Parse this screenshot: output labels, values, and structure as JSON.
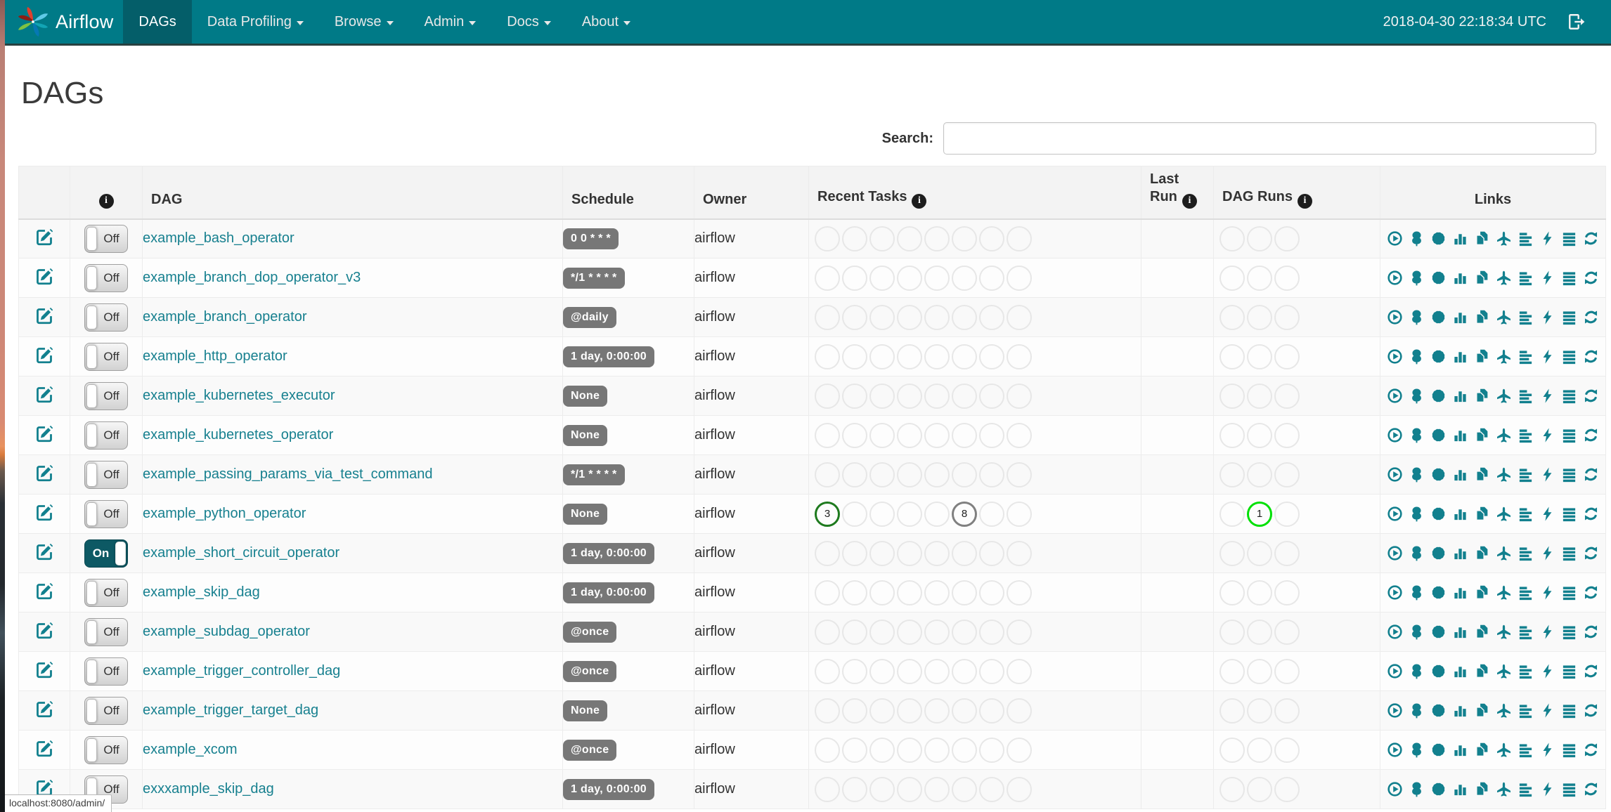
{
  "navbar": {
    "brand": "Airflow",
    "items": [
      {
        "label": "DAGs",
        "active": true,
        "caret": false
      },
      {
        "label": "Data Profiling",
        "active": false,
        "caret": true
      },
      {
        "label": "Browse",
        "active": false,
        "caret": true
      },
      {
        "label": "Admin",
        "active": false,
        "caret": true
      },
      {
        "label": "Docs",
        "active": false,
        "caret": true
      },
      {
        "label": "About",
        "active": false,
        "caret": true
      }
    ],
    "clock": "2018-04-30 22:18:34 UTC"
  },
  "page": {
    "title": "DAGs",
    "search_label": "Search:",
    "search_value": "",
    "status_bar": "localhost:8080/admin/"
  },
  "icons": {
    "info_glyph": "i"
  },
  "table": {
    "headers": {
      "dag": "DAG",
      "schedule": "Schedule",
      "owner": "Owner",
      "recent_tasks": "Recent Tasks",
      "last_run_line1": "Last",
      "last_run_line2": "Run",
      "dag_runs": "DAG Runs",
      "links": "Links"
    },
    "toggle": {
      "on_label": "On",
      "off_label": "Off"
    },
    "recent_task_slots": 8,
    "dag_run_slots": 3,
    "link_icons": [
      "play-circle",
      "tree",
      "starburst",
      "bar-chart",
      "duplicate",
      "plane",
      "align-left",
      "flash",
      "align-justify",
      "refresh"
    ],
    "rows": [
      {
        "name": "example_bash_operator",
        "schedule": "0 0 * * *",
        "owner": "airflow",
        "enabled": false,
        "last_run": "",
        "recent_tasks": {},
        "dag_runs": {}
      },
      {
        "name": "example_branch_dop_operator_v3",
        "schedule": "*/1 * * * *",
        "owner": "airflow",
        "enabled": false,
        "last_run": "",
        "recent_tasks": {},
        "dag_runs": {}
      },
      {
        "name": "example_branch_operator",
        "schedule": "@daily",
        "owner": "airflow",
        "enabled": false,
        "last_run": "",
        "recent_tasks": {},
        "dag_runs": {}
      },
      {
        "name": "example_http_operator",
        "schedule": "1 day, 0:00:00",
        "owner": "airflow",
        "enabled": false,
        "last_run": "",
        "recent_tasks": {},
        "dag_runs": {}
      },
      {
        "name": "example_kubernetes_executor",
        "schedule": "None",
        "owner": "airflow",
        "enabled": false,
        "last_run": "",
        "recent_tasks": {},
        "dag_runs": {}
      },
      {
        "name": "example_kubernetes_operator",
        "schedule": "None",
        "owner": "airflow",
        "enabled": false,
        "last_run": "",
        "recent_tasks": {},
        "dag_runs": {}
      },
      {
        "name": "example_passing_params_via_test_command",
        "schedule": "*/1 * * * *",
        "owner": "airflow",
        "enabled": false,
        "last_run": "",
        "recent_tasks": {},
        "dag_runs": {}
      },
      {
        "name": "example_python_operator",
        "schedule": "None",
        "owner": "airflow",
        "enabled": false,
        "last_run": "",
        "recent_tasks": {
          "0": {
            "count": "3",
            "state": "success"
          },
          "5": {
            "count": "8",
            "state": "queued"
          }
        },
        "dag_runs": {
          "1": {
            "count": "1",
            "state": "running"
          }
        }
      },
      {
        "name": "example_short_circuit_operator",
        "schedule": "1 day, 0:00:00",
        "owner": "airflow",
        "enabled": true,
        "last_run": "",
        "recent_tasks": {},
        "dag_runs": {}
      },
      {
        "name": "example_skip_dag",
        "schedule": "1 day, 0:00:00",
        "owner": "airflow",
        "enabled": false,
        "last_run": "",
        "recent_tasks": {},
        "dag_runs": {}
      },
      {
        "name": "example_subdag_operator",
        "schedule": "@once",
        "owner": "airflow",
        "enabled": false,
        "last_run": "",
        "recent_tasks": {},
        "dag_runs": {}
      },
      {
        "name": "example_trigger_controller_dag",
        "schedule": "@once",
        "owner": "airflow",
        "enabled": false,
        "last_run": "",
        "recent_tasks": {},
        "dag_runs": {}
      },
      {
        "name": "example_trigger_target_dag",
        "schedule": "None",
        "owner": "airflow",
        "enabled": false,
        "last_run": "",
        "recent_tasks": {},
        "dag_runs": {}
      },
      {
        "name": "example_xcom",
        "schedule": "@once",
        "owner": "airflow",
        "enabled": false,
        "last_run": "",
        "recent_tasks": {},
        "dag_runs": {}
      },
      {
        "name": "exxxample_skip_dag",
        "schedule": "1 day, 0:00:00",
        "owner": "airflow",
        "enabled": false,
        "last_run": "",
        "recent_tasks": {},
        "dag_runs": {}
      }
    ]
  },
  "colors": {
    "navbar": "#007A87",
    "navbar_active": "#045E69",
    "accent": "#12808E",
    "link": "#17808F",
    "badge": "#777777",
    "states": {
      "success": "#1E7A1E",
      "queued": "#808080",
      "running": "#00E005"
    }
  }
}
